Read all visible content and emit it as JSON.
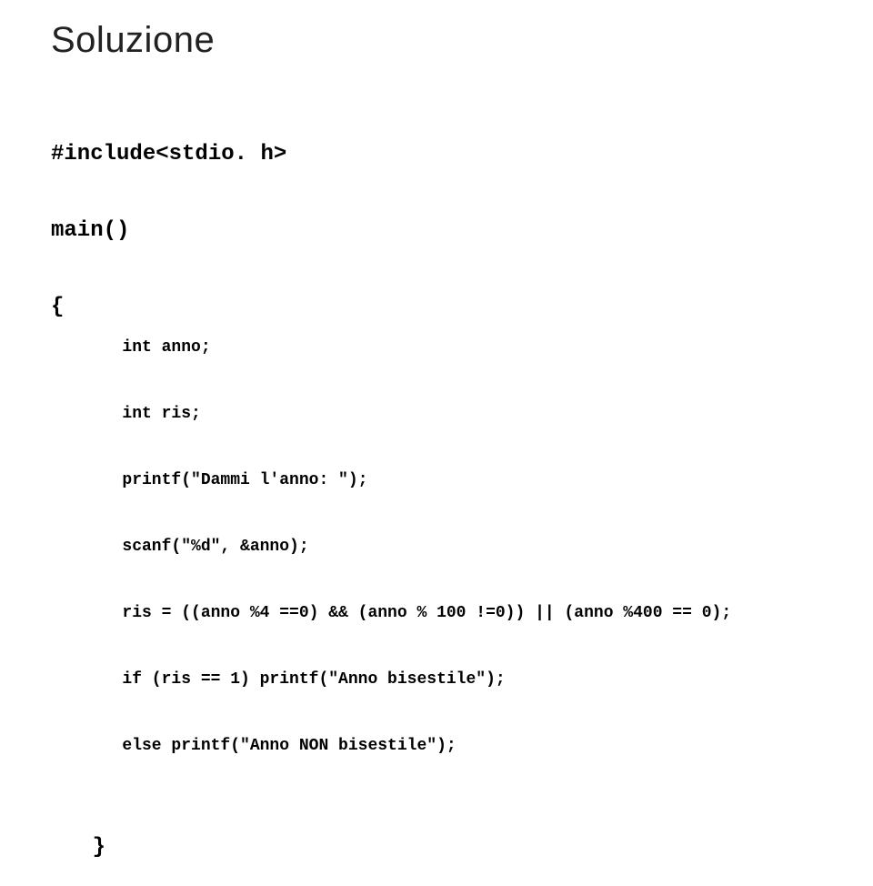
{
  "title": "Soluzione",
  "code": {
    "include": "#include<stdio. h>",
    "main": "main()",
    "open_brace": "{",
    "lines": [
      "int anno;",
      "int ris;",
      "printf(\"Dammi l'anno: \");",
      "scanf(\"%d\", &anno);",
      "ris = ((anno %4 ==0) && (anno % 100 !=0)) || (anno %400 == 0);",
      "if (ris == 1) printf(\"Anno bisestile\");",
      "else printf(\"Anno NON bisestile\");"
    ],
    "close_brace": "}"
  }
}
